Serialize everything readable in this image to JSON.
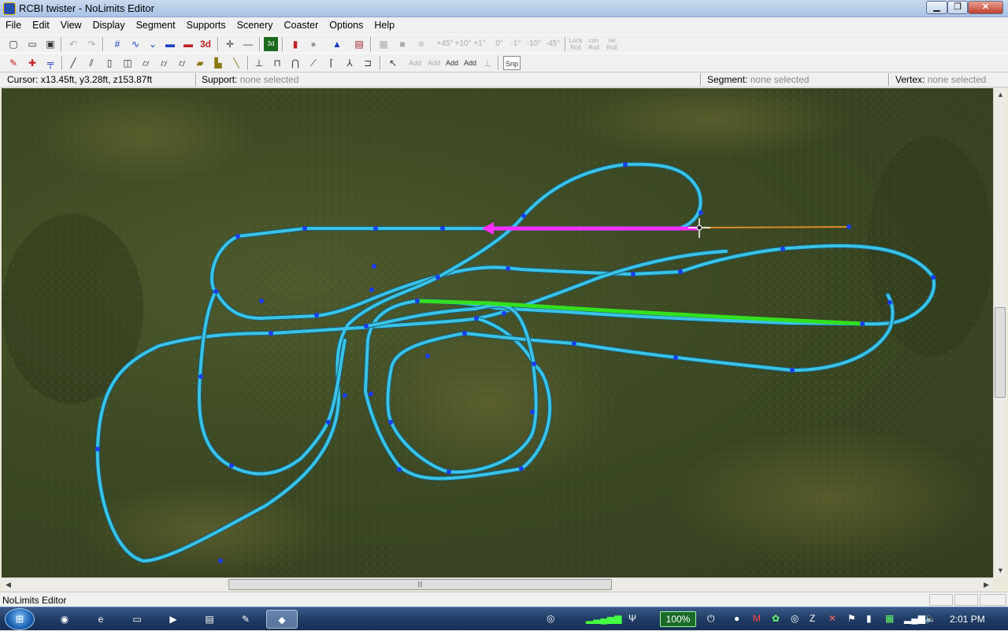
{
  "window": {
    "title": "RCBI twister - NoLimits Editor"
  },
  "menu": [
    "File",
    "Edit",
    "View",
    "Display",
    "Segment",
    "Supports",
    "Scenery",
    "Coaster",
    "Options",
    "Help"
  ],
  "toolbar1": [
    {
      "name": "new-icon",
      "glyph": "▢"
    },
    {
      "name": "open-icon",
      "glyph": "📂"
    },
    {
      "name": "save-icon",
      "glyph": "▣"
    },
    {
      "name": "undo-icon",
      "glyph": "↶"
    },
    {
      "name": "redo-icon",
      "glyph": "↷"
    },
    {
      "name": "track-grid-icon",
      "glyph": "#"
    },
    {
      "name": "track-wave-icon",
      "glyph": "∿"
    },
    {
      "name": "track-curve-icon",
      "glyph": "⌄"
    },
    {
      "name": "train-icon",
      "glyph": "🚃"
    },
    {
      "name": "train-red-icon",
      "glyph": "🚃"
    },
    {
      "name": "3d-label",
      "glyph": "3d"
    },
    {
      "name": "add-point-icon",
      "glyph": "✛"
    },
    {
      "name": "remove-point-icon",
      "glyph": "—"
    },
    {
      "name": "track-view-icon",
      "glyph": "▦"
    },
    {
      "name": "traffic-light-icon",
      "glyph": "▮"
    },
    {
      "name": "stop-icon",
      "glyph": "⛔"
    },
    {
      "name": "warning-icon",
      "glyph": "⚠"
    },
    {
      "name": "display-icon",
      "glyph": "▤"
    }
  ],
  "toolbar1_text": [
    "+45°",
    "+10°",
    "+1°",
    "0°",
    "-1°",
    "-10°",
    "-45°",
    "Lock Roll",
    "con Roll",
    "rel Roll"
  ],
  "toolbar2_text": [
    "Add",
    "Add",
    "Add",
    "Add",
    "Snp"
  ],
  "status": {
    "cursor_label": "Cursor:",
    "cursor_value": "x13.45ft, y3.28ft, z153.87ft",
    "support_label": "Support:",
    "support_value": "none selected",
    "segment_label": "Segment:",
    "segment_value": "none selected",
    "vertex_label": "Vertex:",
    "vertex_value": "none selected"
  },
  "colors": {
    "track": "#39c3e6",
    "vertex": "#1a3cf0",
    "selected_segment": "#ff2dff",
    "lift_segment": "#33e020",
    "transfer_segment": "#d98b2a",
    "ground": "#3e4a24"
  },
  "app_status": "NoLimits Editor",
  "taskbar": {
    "battery": "100%",
    "clock": "2:01 PM"
  }
}
